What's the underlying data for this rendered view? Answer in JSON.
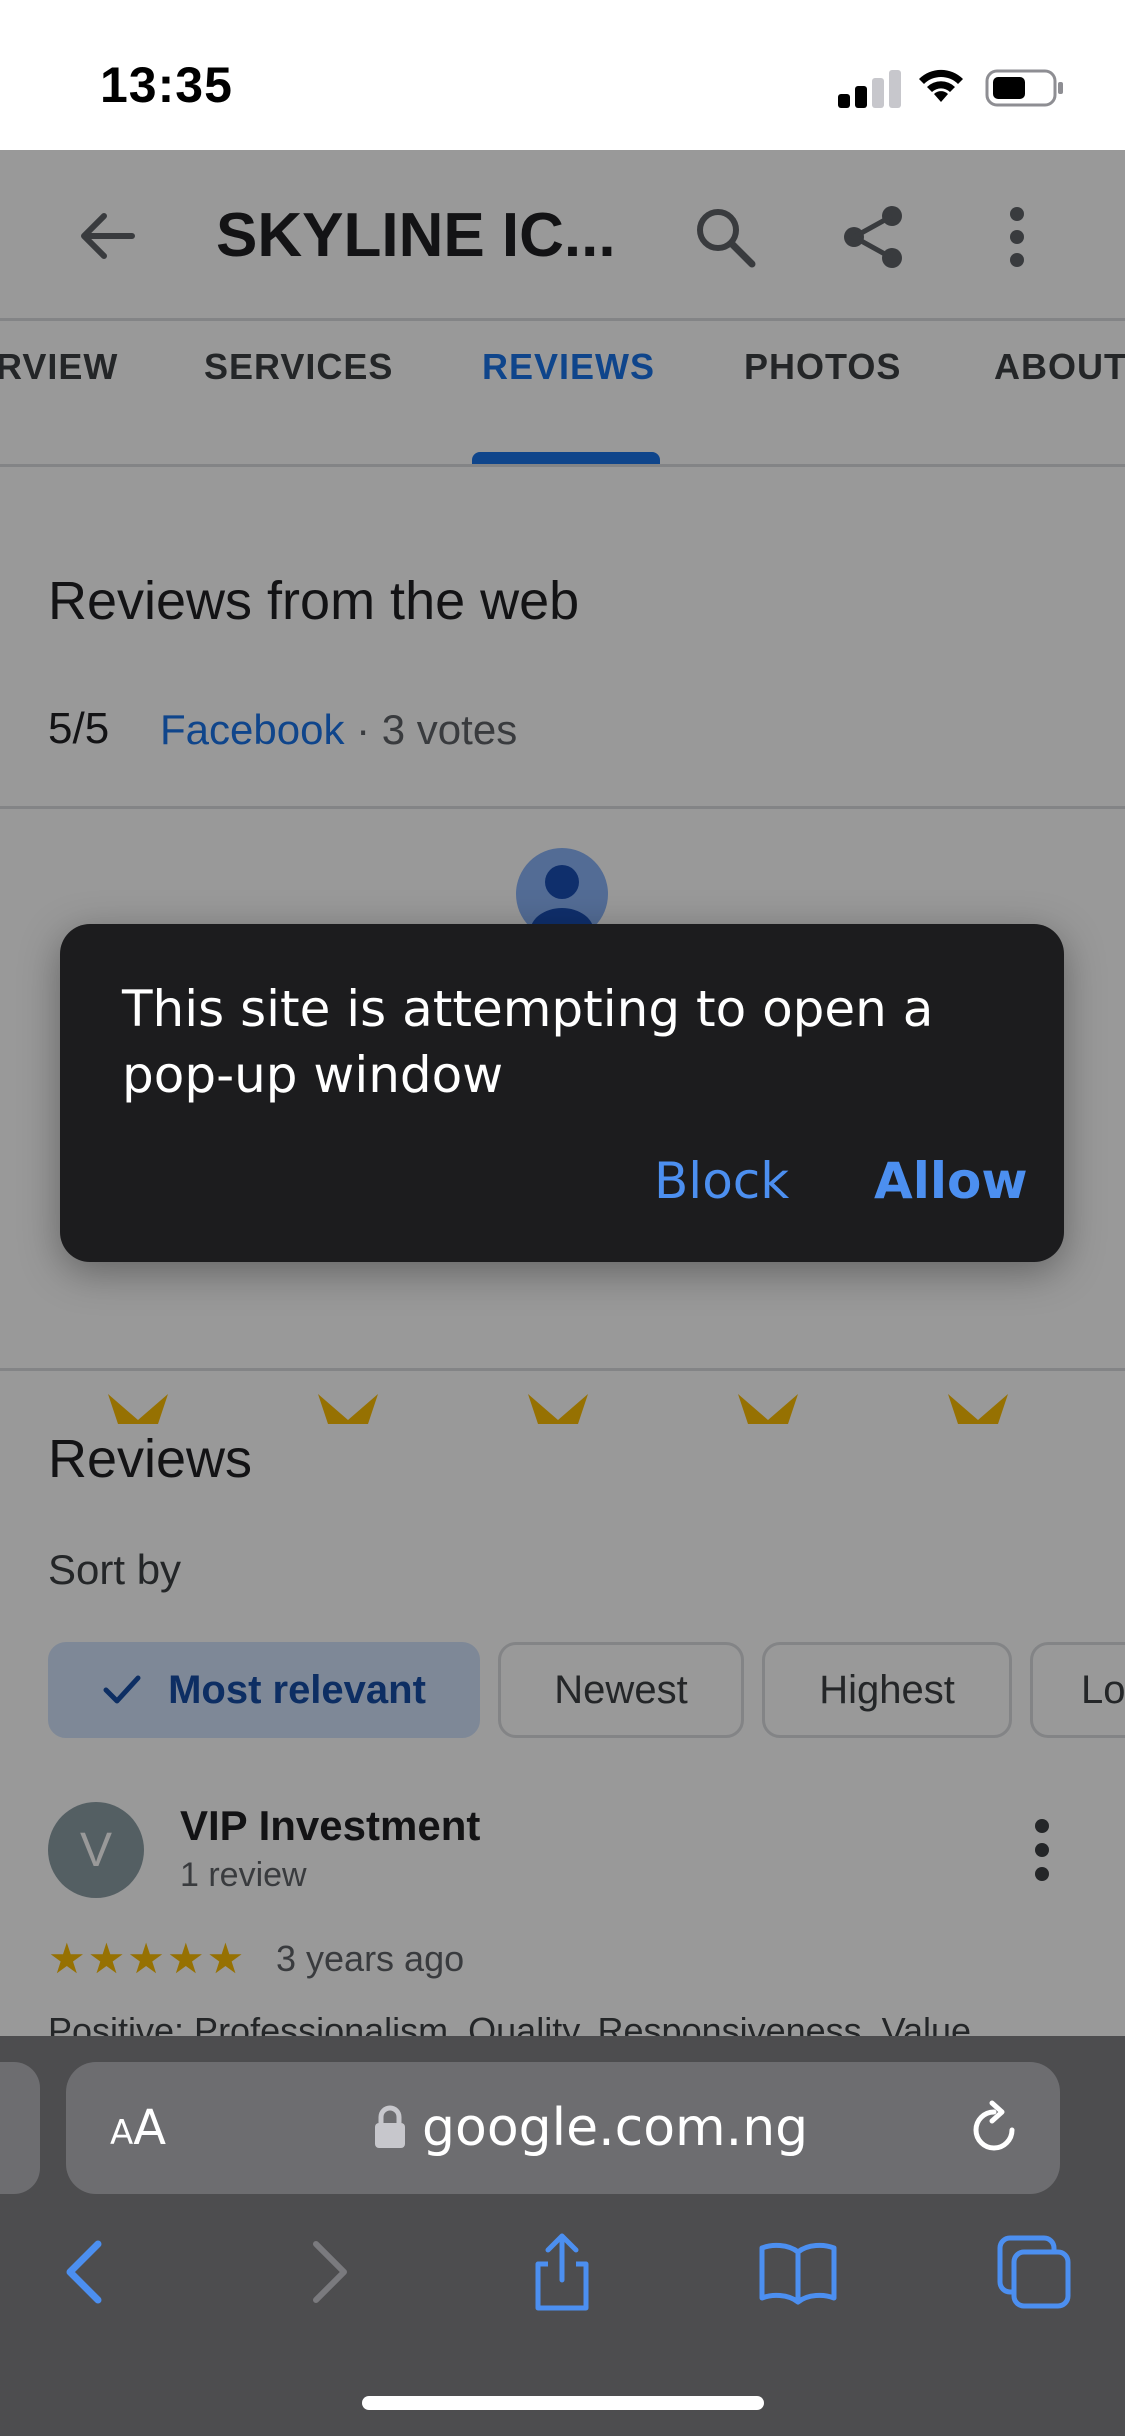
{
  "status_bar": {
    "time": "13:35"
  },
  "header": {
    "title": "SKYLINE IC..."
  },
  "tabs": [
    {
      "label": "RVIEW"
    },
    {
      "label": "SERVICES"
    },
    {
      "label": "REVIEWS"
    },
    {
      "label": "PHOTOS"
    },
    {
      "label": "ABOUT"
    }
  ],
  "web_reviews": {
    "heading": "Reviews from the web",
    "score": "5/5",
    "source": "Facebook",
    "votes": "· 3 votes"
  },
  "dialog": {
    "message": "This site is attempting to open a pop-up window",
    "block_label": "Block",
    "allow_label": "Allow"
  },
  "reviews": {
    "heading": "Reviews",
    "sort_label": "Sort by",
    "chips": [
      {
        "label": "Most relevant"
      },
      {
        "label": "Newest"
      },
      {
        "label": "Highest"
      },
      {
        "label": "Lo"
      }
    ],
    "first_review": {
      "avatar_letter": "V",
      "name": "VIP Investment",
      "count": "1 review",
      "stars": "★★★★★",
      "rating": 5,
      "time": "3 years ago",
      "snippet": "Positive: Professionalism, Quality, Responsiveness, Value"
    }
  },
  "browser": {
    "aa_label": "AA",
    "url": "google.com.ng"
  },
  "colors": {
    "accent": "#1a73e8",
    "star": "#fbbc04",
    "dialog_bg": "#1c1c1e",
    "dialog_button": "#4c8ff0",
    "safari_toolbar": "#4d4d4f"
  },
  "icons": {
    "back": "arrow-left-icon",
    "search": "search-icon",
    "share": "share-icon",
    "more": "more-vertical-icon",
    "lock": "lock-icon",
    "reload": "reload-icon",
    "safari_back": "chevron-left-icon",
    "safari_forward": "chevron-right-icon",
    "safari_share": "share-box-icon",
    "bookmarks": "book-icon",
    "tabs": "tabs-icon"
  }
}
